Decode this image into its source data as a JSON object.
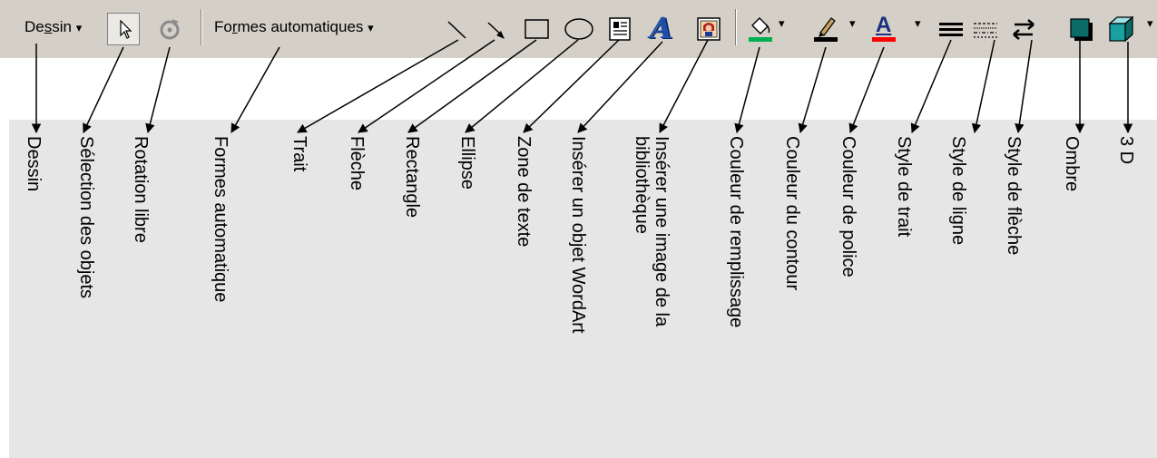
{
  "toolbar": {
    "dessin_prefix": "De",
    "dessin_accel": "s",
    "dessin_suffix": "sin",
    "formes_prefix": "Fo",
    "formes_accel": "r",
    "formes_suffix": "mes automatiques",
    "dropdown_glyph": "▾",
    "wordart_glyph": "A",
    "font_color_glyph": "A",
    "fill_accent": "#00b050",
    "line_accent": "#000000",
    "font_accent": "#ff0000",
    "shadow_color": "#0b6b67"
  },
  "labels": [
    "Dessin",
    "Sélection des objets",
    "Rotation libre",
    "Formes automatique",
    "Trait",
    "Flèche",
    "Rectangle",
    "Ellipse",
    "Zone de texte",
    "Insérer un objet WordArt",
    "Insérer une image de la\nbibliothèque",
    "Couleur de remplissage",
    "Couleur du contour",
    "Couleur de police",
    "Style de trait",
    "Style de ligne",
    "Style de flèche",
    "Ombre",
    "3 D"
  ]
}
